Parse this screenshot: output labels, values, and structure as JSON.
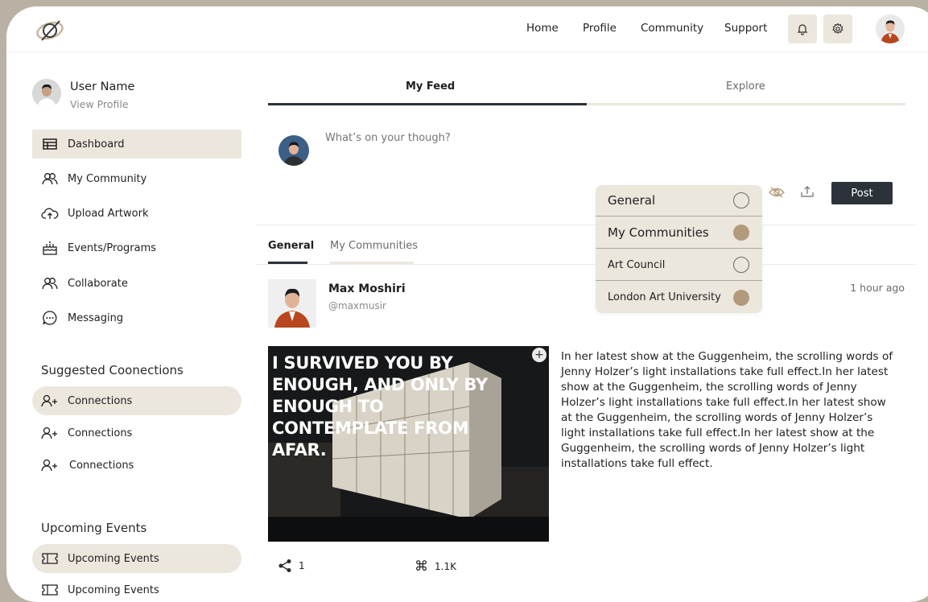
{
  "nav": {
    "links": [
      "Home",
      "Profile",
      "Community",
      "Support"
    ],
    "notification_icon": "bell-icon",
    "settings_icon": "gear-icon"
  },
  "sidebar": {
    "user_name": "User Name",
    "view_profile": "View Profile",
    "menu": [
      {
        "label": "Dashboard",
        "icon": "dashboard-icon"
      },
      {
        "label": "My Community",
        "icon": "people-icon"
      },
      {
        "label": "Upload Artwork",
        "icon": "cloud-upload-icon"
      },
      {
        "label": "Events/Programs",
        "icon": "cake-icon"
      },
      {
        "label": "Collaborate",
        "icon": "people-icon"
      },
      {
        "label": "Messaging",
        "icon": "chat-icon"
      }
    ],
    "suggested_title": "Suggested Coonections",
    "suggested": [
      "Connections",
      "Connections",
      "Connections"
    ],
    "events_title": "Upcoming Events",
    "events": [
      "Upcoming Events",
      "Upcoming Events"
    ]
  },
  "feed_tabs": [
    "My Feed",
    "Explore"
  ],
  "composer": {
    "placeholder": "What’s on your though?",
    "post_label": "Post"
  },
  "sub_tabs": [
    "General",
    "My Communities"
  ],
  "audience_dropdown": [
    {
      "label": "General",
      "selected": false
    },
    {
      "label": "My Communities",
      "selected": true
    },
    {
      "label": "Art Council",
      "selected": false
    },
    {
      "label": "London Art University",
      "selected": true
    }
  ],
  "post": {
    "author": "Max Moshiri",
    "handle": "@maxmusir",
    "time": "1 hour ago",
    "image_caption": "I SURVIVED YOU BY ENOUGH, AND ONLY BY ENOUGH TO CONTEMPLATE FROM AFAR.",
    "body": "In her latest show at the Guggenheim, the scrolling words of Jenny Holzer’s light installations take full effect.In her latest show at the Guggenheim, the scrolling words of Jenny Holzer’s light installations take full effect.In her latest show at the Guggenheim, the scrolling words of Jenny Holzer’s light installations take full effect.In her latest show at the Guggenheim, the scrolling words of Jenny Holzer’s light installations take full effect.",
    "shares": "1",
    "likes": "1.1K"
  },
  "colors": {
    "accent_beige": "#ebe7dd",
    "dark": "#2b323a",
    "dot_selected": "#b39a7c",
    "background": "#b9b1a4"
  }
}
